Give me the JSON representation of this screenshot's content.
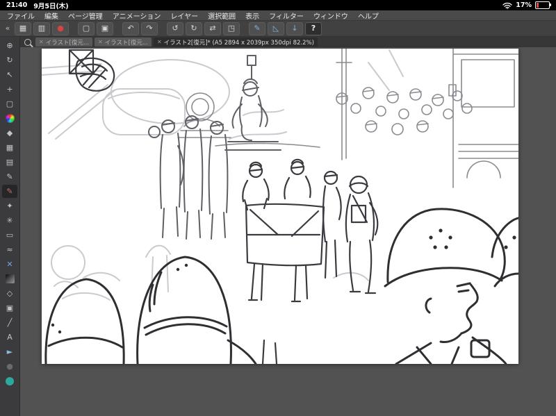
{
  "colors": {
    "app_bg": "#535353",
    "panel": "#3b3b3e",
    "menu_bg": "#4a4a4a",
    "canvas_paper": "#ffffff",
    "accent_blue": "#7fb2e0",
    "record_red": "#d64541",
    "battery_low": "#e0483c",
    "teal_tool": "#2ea79e",
    "sketch_dark": "#2e2e33",
    "sketch_light": "#ccc9cf"
  },
  "status_bar": {
    "time": "21:40",
    "date": "9月5日(木)",
    "battery": "17%",
    "wifi_icon": "wifi"
  },
  "menu_bar": {
    "items": [
      "ファイル",
      "編集",
      "ページ管理",
      "アニメーション",
      "レイヤー",
      "選択範囲",
      "表示",
      "フィルター",
      "ウィンドウ",
      "ヘルプ"
    ]
  },
  "toolbar": {
    "icons": [
      {
        "name": "collapse-panel",
        "glyph": "«"
      },
      {
        "name": "grid-view",
        "glyph": "▦"
      },
      {
        "name": "workspace",
        "glyph": "▥"
      },
      {
        "name": "record",
        "glyph": "●"
      },
      {
        "name": "new-page",
        "glyph": "▢"
      },
      {
        "name": "add-page",
        "glyph": "▣"
      },
      {
        "name": "undo",
        "glyph": "↶"
      },
      {
        "name": "redo",
        "glyph": "↷"
      },
      {
        "name": "rotate-left",
        "glyph": "↺"
      },
      {
        "name": "rotate-right",
        "glyph": "↻"
      },
      {
        "name": "flip-horizontal",
        "glyph": "⇄"
      },
      {
        "name": "crop",
        "glyph": "◳"
      },
      {
        "name": "pen-settings",
        "glyph": "✎"
      },
      {
        "name": "ruler",
        "glyph": "◺"
      },
      {
        "name": "download",
        "glyph": "↓"
      },
      {
        "name": "help",
        "glyph": "?"
      }
    ]
  },
  "tab_bar": {
    "close_glyph": "✕",
    "tabs": [
      {
        "label": "イラスト[復元..."
      },
      {
        "label": "イラスト[復元..."
      },
      {
        "label": "イラスト2[復元]* (A5 2894 x 2039px 350dpi 82.2%)"
      }
    ]
  },
  "tool_sidebar": {
    "tools": [
      {
        "name": "zoom",
        "glyph": "⊕"
      },
      {
        "name": "navigate",
        "glyph": "↻"
      },
      {
        "name": "operation",
        "glyph": "↖"
      },
      {
        "name": "move",
        "glyph": "+"
      },
      {
        "name": "marquee-select",
        "glyph": "▢"
      },
      {
        "name": "color-wheel",
        "glyph": ""
      },
      {
        "name": "eyedropper",
        "glyph": "◆"
      },
      {
        "name": "color-set",
        "glyph": "▦"
      },
      {
        "name": "sub-palette",
        "glyph": "▤"
      },
      {
        "name": "pen",
        "glyph": "✎"
      },
      {
        "name": "brush",
        "glyph": "✎"
      },
      {
        "name": "airbrush",
        "glyph": "✦"
      },
      {
        "name": "decoration",
        "glyph": "✳"
      },
      {
        "name": "eraser",
        "glyph": "▭"
      },
      {
        "name": "blend",
        "glyph": "≈"
      },
      {
        "name": "fill",
        "glyph": "✕"
      },
      {
        "name": "gradient",
        "glyph": ""
      },
      {
        "name": "figure",
        "glyph": "◇"
      },
      {
        "name": "frame-border",
        "glyph": "▣"
      },
      {
        "name": "ruler-tool",
        "glyph": "╱"
      },
      {
        "name": "text",
        "glyph": "A"
      },
      {
        "name": "arrow-pointer",
        "glyph": "►"
      },
      {
        "name": "shape-dark",
        "glyph": "●"
      },
      {
        "name": "special-teal",
        "glyph": ""
      }
    ]
  }
}
